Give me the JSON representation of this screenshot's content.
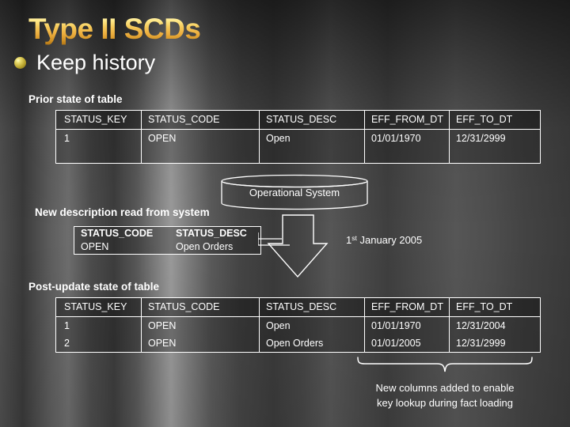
{
  "slide": {
    "title": "Type II SCDs",
    "bullet": "Keep history",
    "bullet_icon": "gold-sphere-bullet"
  },
  "captions": {
    "prior": "Prior state of table",
    "new_description": "New description read from system",
    "post_update": "Post-update state of table",
    "date": "January 2005",
    "date_ordinal_number": "1",
    "date_ordinal_suffix": "st"
  },
  "operational_system": {
    "label": "Operational System",
    "icon": "database-cylinder-icon",
    "arrow_icon": "down-arrow-icon"
  },
  "prior_table": {
    "columns": [
      "STATUS_KEY",
      "STATUS_CODE",
      "STATUS_DESC",
      "EFF_FROM_DT",
      "EFF_TO_DT"
    ],
    "rows": [
      [
        "1",
        "OPEN",
        "Open",
        "01/01/1970",
        "12/31/2999"
      ]
    ]
  },
  "new_description_box": {
    "columns": [
      "STATUS_CODE",
      "STATUS_DESC"
    ],
    "rows": [
      [
        "OPEN",
        "Open Orders"
      ]
    ]
  },
  "post_table": {
    "columns": [
      "STATUS_KEY",
      "STATUS_CODE",
      "STATUS_DESC",
      "EFF_FROM_DT",
      "EFF_TO_DT"
    ],
    "rows": [
      [
        "1",
        "OPEN",
        "Open",
        "01/01/1970",
        "12/31/2004"
      ],
      [
        "2",
        "OPEN",
        "Open Orders",
        "01/01/2005",
        "12/31/2999"
      ]
    ]
  },
  "footnote": {
    "line1": "New columns added to enable",
    "line2": "key lookup during fact loading",
    "brace_icon": "curly-brace-icon"
  },
  "colors": {
    "title_gold_light": "#fffbdc",
    "title_gold_dark": "#a97014",
    "text": "#ffffff",
    "background": "#4a4a4a",
    "bullet": "#d9c65a"
  }
}
